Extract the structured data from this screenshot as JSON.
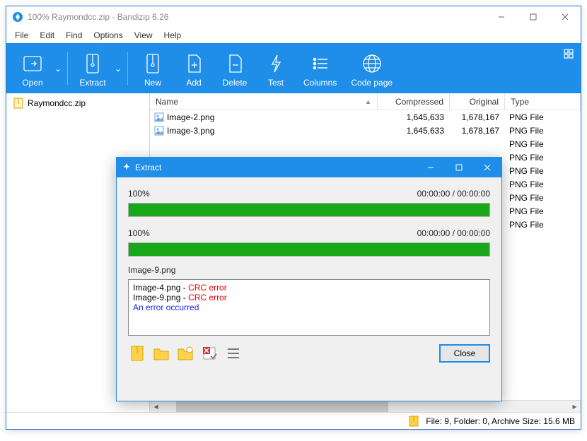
{
  "window": {
    "title": "100% Raymondcc.zip - Bandizip 6.26"
  },
  "menu": [
    "File",
    "Edit",
    "Find",
    "Options",
    "View",
    "Help"
  ],
  "toolbar": {
    "open": "Open",
    "extract": "Extract",
    "new": "New",
    "add": "Add",
    "delete": "Delete",
    "test": "Test",
    "columns": "Columns",
    "codepage": "Code page"
  },
  "tree": {
    "root": "Raymondcc.zip"
  },
  "columns": {
    "name": "Name",
    "compressed": "Compressed",
    "original": "Original",
    "type": "Type"
  },
  "files": [
    {
      "name": "Image-2.png",
      "compressed": "1,645,633",
      "original": "1,678,167",
      "type": "PNG File"
    },
    {
      "name": "Image-3.png",
      "compressed": "1,645,633",
      "original": "1,678,167",
      "type": "PNG File"
    },
    {
      "name": "",
      "compressed": "",
      "original": "",
      "type": "PNG File"
    },
    {
      "name": "",
      "compressed": "",
      "original": "",
      "type": "PNG File"
    },
    {
      "name": "",
      "compressed": "",
      "original": "",
      "type": "PNG File"
    },
    {
      "name": "",
      "compressed": "",
      "original": "",
      "type": "PNG File"
    },
    {
      "name": "",
      "compressed": "",
      "original": "",
      "type": "PNG File"
    },
    {
      "name": "",
      "compressed": "",
      "original": "",
      "type": "PNG File"
    },
    {
      "name": "",
      "compressed": "",
      "original": "",
      "type": "PNG File"
    }
  ],
  "status": "File: 9, Folder: 0, Archive Size: 15.6 MB",
  "dialog": {
    "title": "Extract",
    "p1_pct": "100%",
    "p1_time": "00:00:00 / 00:00:00",
    "p2_pct": "100%",
    "p2_time": "00:00:00 / 00:00:00",
    "current": "Image-9.png",
    "log": [
      {
        "file": "Image-4.png",
        "sep": " - ",
        "err": "CRC error"
      },
      {
        "file": "Image-9.png",
        "sep": " - ",
        "err": "CRC error"
      }
    ],
    "msg": "An error occurred",
    "close": "Close"
  }
}
